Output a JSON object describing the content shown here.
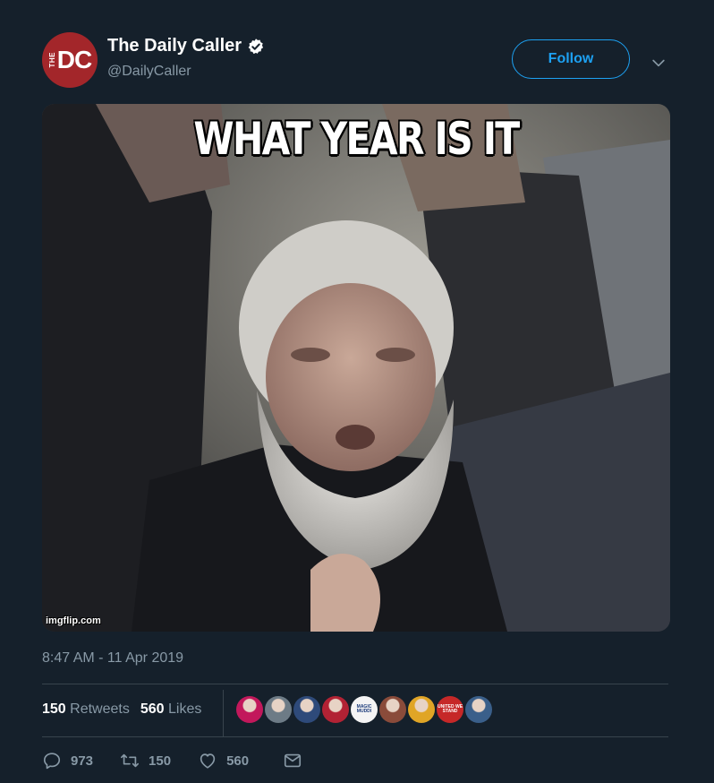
{
  "author": {
    "avatar_small_text": "THE",
    "avatar_main_text": "DC",
    "display_name": "The Daily Caller",
    "handle": "@DailyCaller",
    "verified": true
  },
  "follow_label": "Follow",
  "media": {
    "caption": "WHAT YEAR IS IT",
    "watermark": "imgflip.com"
  },
  "timestamp": "8:47 AM - 11 Apr 2019",
  "stats": {
    "retweets_count": "150",
    "retweets_label": "Retweets",
    "likes_count": "560",
    "likes_label": "Likes"
  },
  "liker_avatars": [
    {
      "color": "#c2185b"
    },
    {
      "color": "#6d7b86"
    },
    {
      "color": "#2e4a7a"
    },
    {
      "color": "#b22234"
    },
    {
      "color": "#f4f4f4",
      "text": "MAGIC MUDDI"
    },
    {
      "color": "#8a4b3a"
    },
    {
      "color": "#e0a526"
    },
    {
      "color": "#c62828",
      "text": "UNITED WE STAND"
    },
    {
      "color": "#3a5f8a"
    }
  ],
  "actions": {
    "replies": "973",
    "retweets": "150",
    "likes": "560"
  },
  "colors": {
    "background": "#15202b",
    "accent": "#1da1f2",
    "muted": "#8899a6",
    "divider": "#38444d"
  }
}
